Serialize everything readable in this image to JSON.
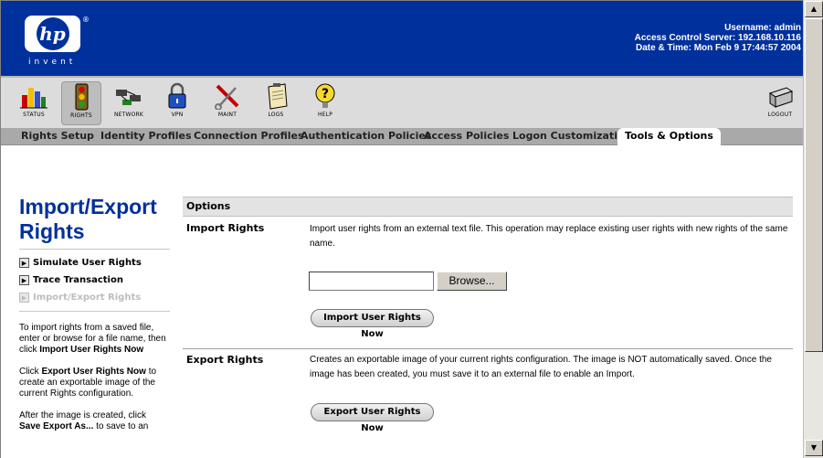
{
  "header": {
    "logo_text": "hp",
    "logo_tagline": "invent",
    "logo_reg": "®",
    "info": [
      {
        "label": "Username:",
        "value": "admin"
      },
      {
        "label": "Access Control Server:",
        "value": "192.168.10.116"
      },
      {
        "label": "Date & Time:",
        "value": "Mon Feb 9 17:44:57 2004"
      }
    ]
  },
  "toolbar": {
    "items": [
      {
        "label": "STATUS",
        "icon": "status-chart-icon"
      },
      {
        "label": "RIGHTS",
        "icon": "traffic-light-icon"
      },
      {
        "label": "NETWORK",
        "icon": "network-icon"
      },
      {
        "label": "VPN",
        "icon": "padlock-icon"
      },
      {
        "label": "MAINT",
        "icon": "wrench-screwdriver-icon"
      },
      {
        "label": "LOGS",
        "icon": "clipboard-icon"
      },
      {
        "label": "HELP",
        "icon": "help-question-icon"
      },
      {
        "label": "LOGOUT",
        "icon": "logout-server-icon"
      }
    ]
  },
  "tabs": [
    {
      "label": "Rights Setup"
    },
    {
      "label": "Identity Profiles"
    },
    {
      "label": "Connection Profiles"
    },
    {
      "label": "Authentication Policies"
    },
    {
      "label": "Access Policies"
    },
    {
      "label": "Logon Customization"
    },
    {
      "label": "Tools & Options",
      "active": true
    }
  ],
  "sidebar": {
    "title_line1": "Import/Export",
    "title_line2": "Rights",
    "links": [
      {
        "label": "Simulate User Rights",
        "enabled": true
      },
      {
        "label": "Trace Transaction",
        "enabled": true
      },
      {
        "label": "Import/Export Rights",
        "enabled": false
      }
    ],
    "help1_a": "To import rights from a saved file, enter or browse for a file name, then click ",
    "help1_b": "Import User Rights Now",
    "help2_a": "Click ",
    "help2_b": "Export User Rights Now",
    "help2_c": " to create an exportable image of the current Rights configuration.",
    "help3_a": "After the image is created, click ",
    "help3_b": "Save Export As...",
    "help3_c": " to save to an"
  },
  "options": {
    "header": "Options",
    "import": {
      "label": "Import Rights",
      "description": "Import user rights from an external text file. This operation may replace existing user rights with new rights of the same name.",
      "file_value": "",
      "browse_label": "Browse...",
      "button_label": "Import User Rights Now"
    },
    "export": {
      "label": "Export Rights",
      "description": "Creates an exportable image of your current rights configuration. The image is NOT automatically saved. Once the image has been created, you must save it to an external file to enable an Import.",
      "button_label": "Export User Rights Now"
    }
  },
  "scrollbar": {
    "up": "▲",
    "down": "▼"
  },
  "colors": {
    "brand_blue": "#00309c",
    "tab_bar": "#a9a9a9",
    "toolbar": "#dcdcdc"
  }
}
